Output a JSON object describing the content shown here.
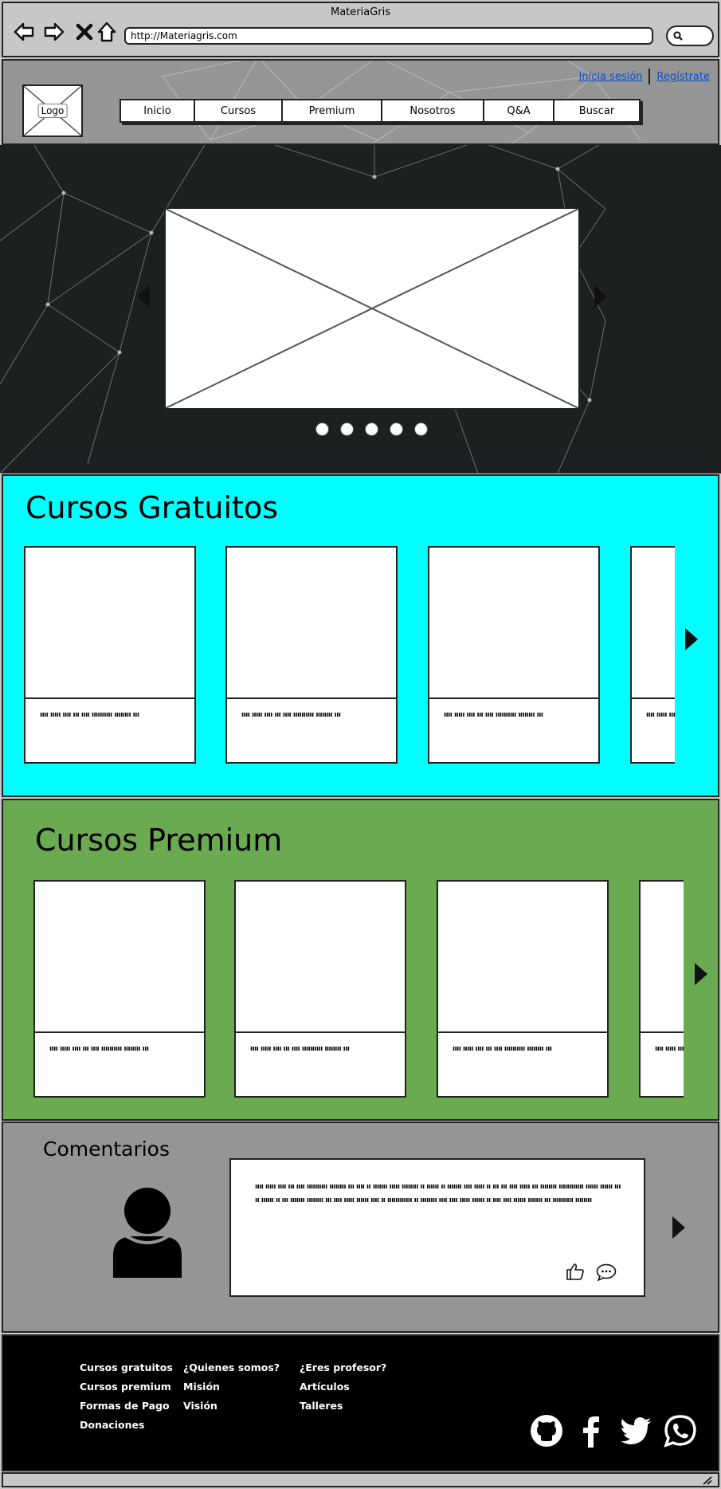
{
  "window": {
    "title": "MateriaGris"
  },
  "browser": {
    "url": "http://Materiagris.com"
  },
  "header": {
    "logo_label": "Logo",
    "menu": [
      {
        "label": "Inicio"
      },
      {
        "label": "Cursos"
      },
      {
        "label": "Premium"
      },
      {
        "label": "Nosotros"
      },
      {
        "label": "Q&A"
      },
      {
        "label": "Buscar"
      }
    ],
    "login_label": "Inicia sesión",
    "register_label": "Regístrate"
  },
  "hero": {
    "slide_count": 5,
    "active_slide": 0
  },
  "free_courses": {
    "title": "Cursos Gratuitos",
    "cards": [
      {
        "caption": "ıııı ııııı ıııı ııı ıııı ıııııııııı ıııııııı ııı"
      },
      {
        "caption": "ıııı ııııı ıııı ııı ıııı ıııııııııı ıııııııı ııı"
      },
      {
        "caption": "ıııı ııııı ıııı ııı ıııı ıııııııııı ıııııııı ııı"
      },
      {
        "caption": "ıııı ııııı ıııı ııı ıııı ıııııııııı ıııııııı ııı"
      }
    ]
  },
  "premium_courses": {
    "title": "Cursos Premium",
    "cards": [
      {
        "caption": "ıııı ııııı ıııı ııı ıııı ıııııııııı ıııııııı ııı"
      },
      {
        "caption": "ıııı ııııı ıııı ııı ıııı ıııııııııı ıııııııı ııı"
      },
      {
        "caption": "ıııı ııııı ıııı ııı ıııı ıııııııııı ıııııııı ııı"
      },
      {
        "caption": "ıııı ııııı ıııı ııı ıııı ıııııııııı ıııııııı ııı"
      }
    ]
  },
  "comments": {
    "title": "Comentarios",
    "text": "ıııı ııııı ıııı ııı ıııı ıııııııııı ıııııııı ııı ıııı ıı ııııııı ııııı ıııııııı ıı ıııııı ıı ııııııı ıııı ııııı ıı ııı ııı ıııı ııııı ııı ıııııııı ıııııııııııı ıııııı ıııııı ııı ıı ıııııı ıı ııı ııııııı ıııııııı ııı ıııı ııııı ıııııı ıııı ıı ıııııııııııı ıı ıııııııı ıııı ıııı ııııı ıııııı ıı ıııı ıııı ıııııı ııııııı ııı ıııııııııı ıııııııı"
  },
  "footer": {
    "col1": [
      "Cursos gratuitos",
      "Cursos premium",
      "Formas de Pago",
      "Donaciones"
    ],
    "col2": [
      "¿Quienes somos?",
      "Misión",
      "Visión"
    ],
    "col3": [
      "¿Eres profesor?",
      "Artículos",
      "Talleres"
    ],
    "social": [
      "github-icon",
      "facebook-icon",
      "twitter-icon",
      "whatsapp-icon"
    ]
  },
  "colors": {
    "free_bg": "#00ffff",
    "premium_bg": "#6aab51",
    "comments_bg": "#959595",
    "footer_bg": "#000000",
    "link": "#0b4fc7"
  }
}
